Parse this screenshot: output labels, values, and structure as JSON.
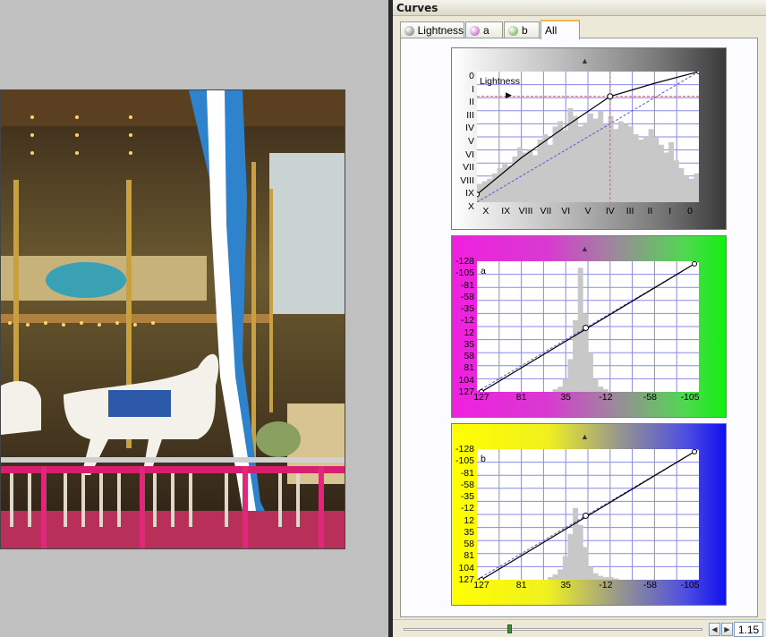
{
  "panel": {
    "title": "Curves"
  },
  "tabs": [
    {
      "label": "Lightness",
      "dot_color": "#6b6b6b",
      "active": false
    },
    {
      "label": "a",
      "dot_color": "#b044c0",
      "active": false
    },
    {
      "label": "b",
      "dot_color": "#5aa02a",
      "active": false
    },
    {
      "label": "All",
      "active": true
    }
  ],
  "lightness": {
    "title": "Lightness",
    "y_labels": [
      "0",
      "I",
      "II",
      "III",
      "IV",
      "V",
      "VI",
      "VII",
      "VIII",
      "IX",
      "X"
    ],
    "x_labels": [
      "X",
      "IX",
      "VIII",
      "VII",
      "VI",
      "V",
      "IV",
      "III",
      "II",
      "I",
      "0"
    ],
    "curve": [
      [
        0,
        0.06
      ],
      [
        0.2,
        0.34
      ],
      [
        0.4,
        0.58
      ],
      [
        0.6,
        0.81
      ],
      [
        0.8,
        0.91
      ],
      [
        1.0,
        1.0
      ]
    ],
    "control_point": [
      0.6,
      0.81
    ],
    "histogram": [
      0.14,
      0.16,
      0.18,
      0.22,
      0.26,
      0.3,
      0.28,
      0.35,
      0.42,
      0.38,
      0.4,
      0.36,
      0.48,
      0.52,
      0.44,
      0.58,
      0.62,
      0.55,
      0.72,
      0.66,
      0.58,
      0.61,
      0.68,
      0.64,
      0.7,
      0.6,
      0.66,
      0.56,
      0.62,
      0.6,
      0.58,
      0.52,
      0.48,
      0.5,
      0.56,
      0.5,
      0.44,
      0.38,
      0.46,
      0.32,
      0.26,
      0.2,
      0.18,
      0.22
    ]
  },
  "a_channel": {
    "title": "a",
    "y_labels": [
      "-128",
      "-105",
      "-81",
      "-58",
      "-35",
      "-12",
      "12",
      "35",
      "58",
      "81",
      "104",
      "127"
    ],
    "x_labels": [
      "127",
      "81",
      "35",
      "-12",
      "-58",
      "-105"
    ],
    "curve": [
      [
        0.02,
        0
      ],
      [
        0.98,
        0.98
      ]
    ],
    "control_point": [
      0.49,
      0.49
    ],
    "histogram": [
      0,
      0,
      0,
      0,
      0,
      0,
      0,
      0,
      0,
      0,
      0,
      0,
      0,
      0,
      0,
      0.02,
      0.04,
      0.1,
      0.25,
      0.55,
      0.95,
      0.6,
      0.3,
      0.1,
      0.04,
      0.02,
      0,
      0,
      0,
      0,
      0,
      0,
      0,
      0,
      0,
      0,
      0,
      0,
      0,
      0,
      0,
      0,
      0,
      0
    ]
  },
  "b_channel": {
    "title": "b",
    "y_labels": [
      "-128",
      "-105",
      "-81",
      "-58",
      "-35",
      "-12",
      "12",
      "35",
      "58",
      "81",
      "104",
      "127"
    ],
    "x_labels": [
      "127",
      "81",
      "35",
      "-12",
      "-58",
      "-105"
    ],
    "curve": [
      [
        0.02,
        0
      ],
      [
        0.98,
        0.98
      ]
    ],
    "control_point": [
      0.49,
      0.49
    ],
    "histogram": [
      0,
      0,
      0,
      0,
      0,
      0,
      0,
      0,
      0,
      0,
      0,
      0,
      0,
      0,
      0.02,
      0.04,
      0.08,
      0.18,
      0.35,
      0.55,
      0.42,
      0.25,
      0.1,
      0.05,
      0.03,
      0.02,
      0.02,
      0.01,
      0,
      0,
      0,
      0,
      0,
      0,
      0,
      0,
      0,
      0,
      0,
      0,
      0,
      0,
      0,
      0
    ]
  },
  "bottom": {
    "zoom": "1.15"
  }
}
